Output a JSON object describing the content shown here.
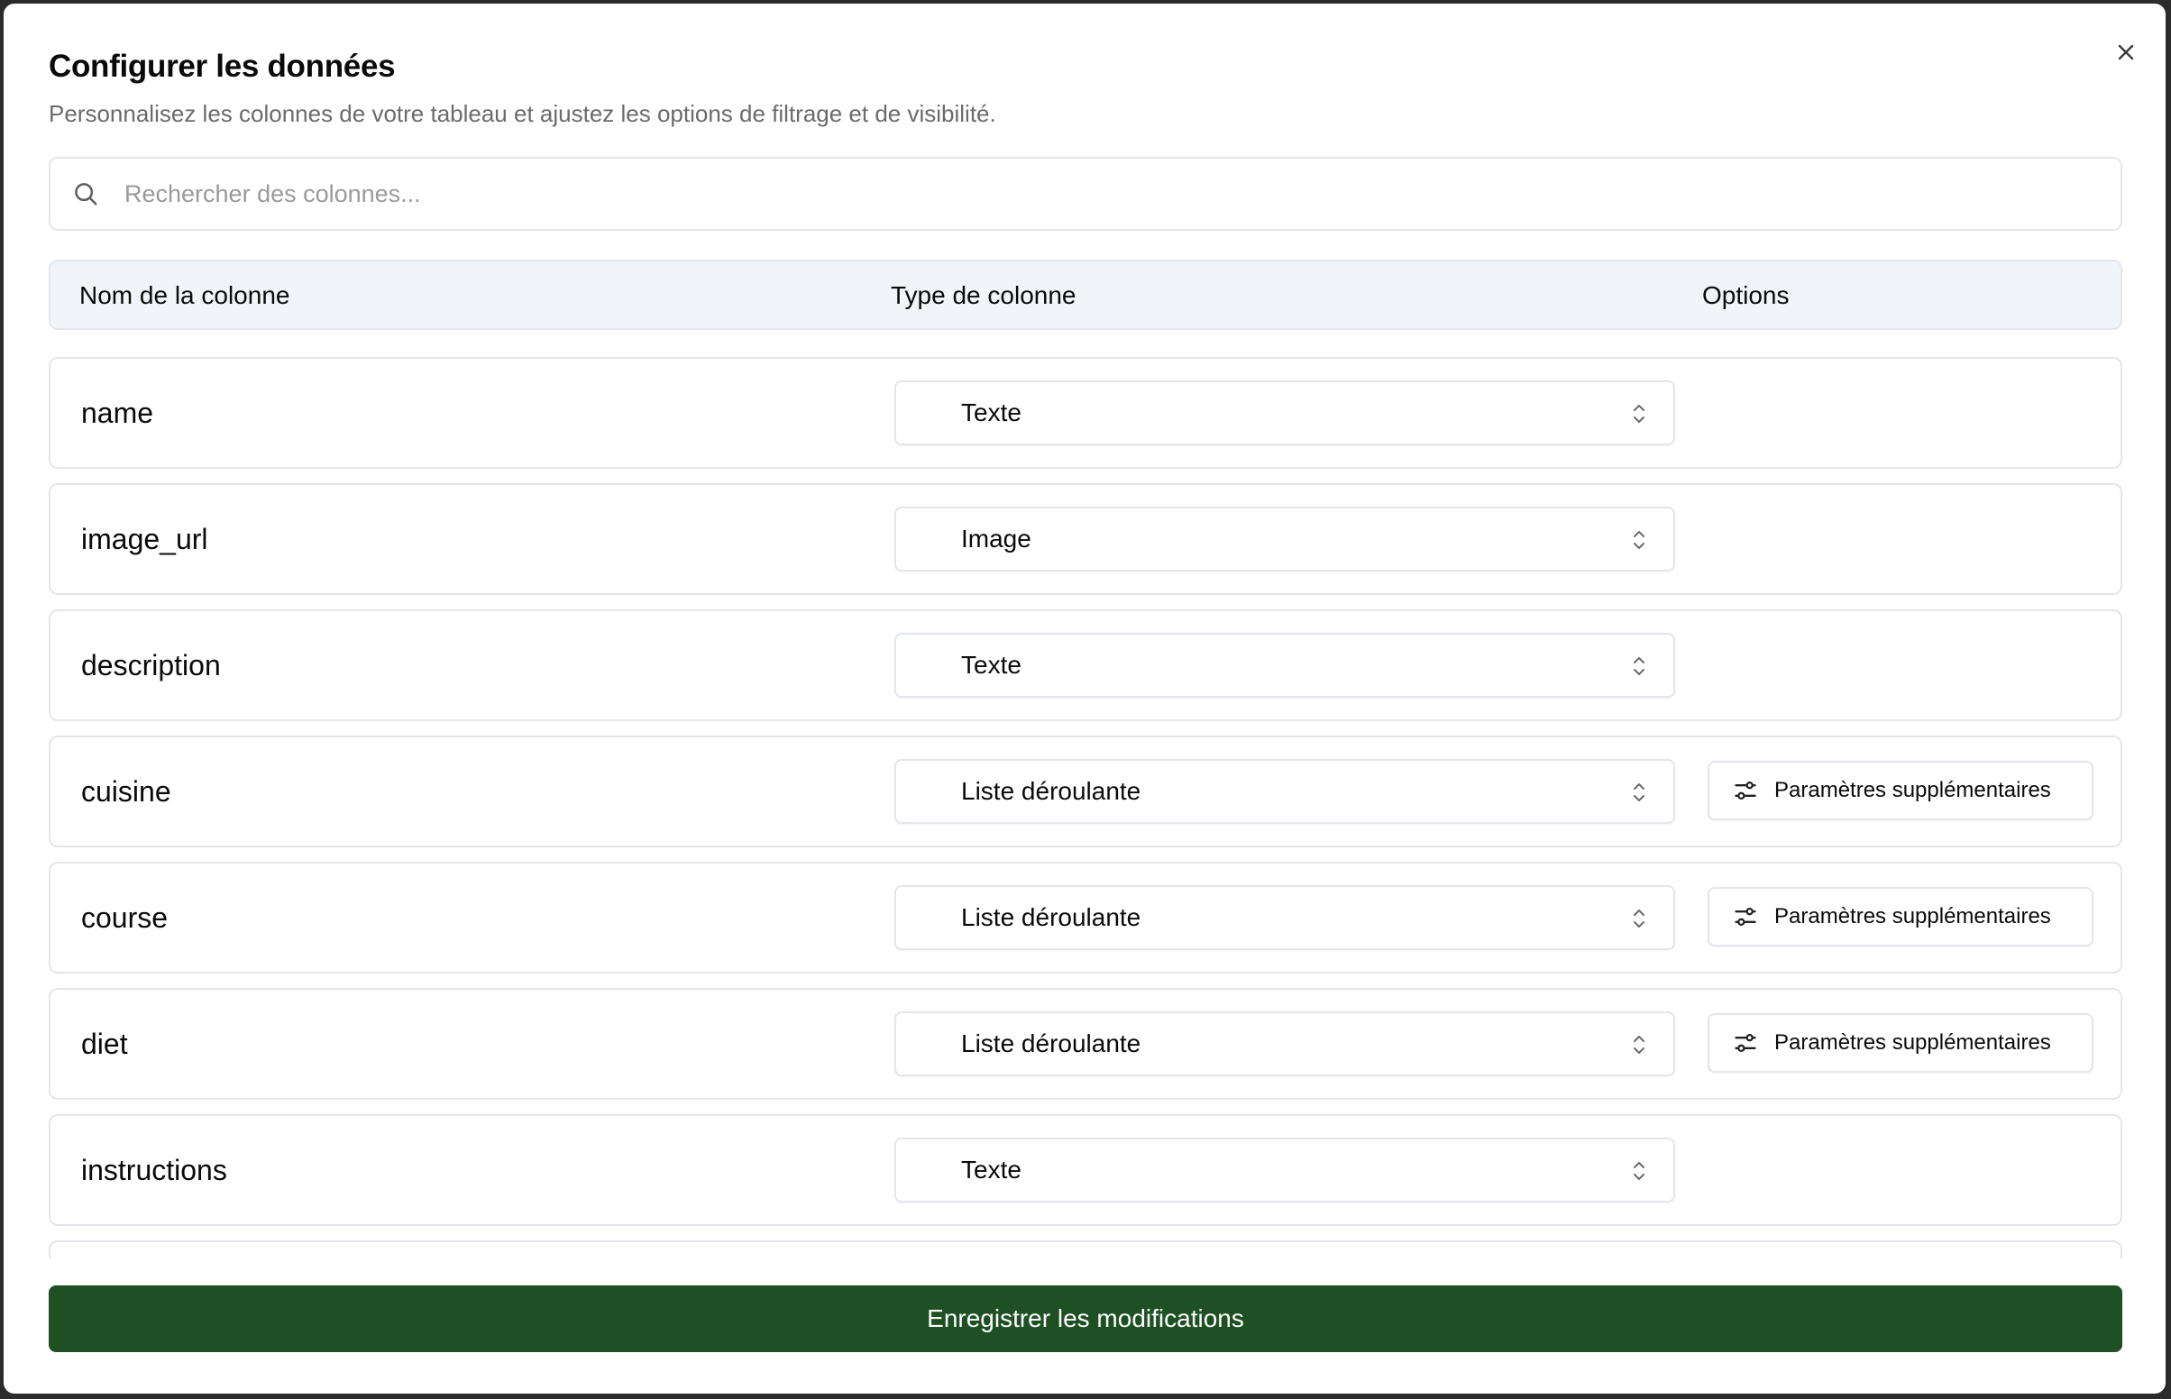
{
  "dialog": {
    "title": "Configurer les données",
    "subtitle": "Personnalisez les colonnes de votre tableau et ajustez les options de filtrage et de visibilité."
  },
  "search": {
    "placeholder": "Rechercher des colonnes...",
    "value": ""
  },
  "table": {
    "headers": {
      "name": "Nom de la colonne",
      "type": "Type de colonne",
      "options": "Options"
    },
    "rows": [
      {
        "name": "name",
        "type": "Texte",
        "options_label": ""
      },
      {
        "name": "image_url",
        "type": "Image",
        "options_label": ""
      },
      {
        "name": "description",
        "type": "Texte",
        "options_label": ""
      },
      {
        "name": "cuisine",
        "type": "Liste déroulante",
        "options_label": "Paramètres supplémentaires"
      },
      {
        "name": "course",
        "type": "Liste déroulante",
        "options_label": "Paramètres supplémentaires"
      },
      {
        "name": "diet",
        "type": "Liste déroulante",
        "options_label": "Paramètres supplémentaires"
      },
      {
        "name": "instructions",
        "type": "Texte",
        "options_label": ""
      }
    ]
  },
  "footer": {
    "save_label": "Enregistrer les modifications"
  },
  "icons": {
    "close": "close-icon",
    "search": "search-icon",
    "select": "chevron-up-down-icon",
    "params": "sliders-icon"
  },
  "colors": {
    "primary": "#1e5024",
    "header_bg": "#f1f4f8",
    "border": "#e3e6ea",
    "muted_text": "#6b6b6b"
  }
}
